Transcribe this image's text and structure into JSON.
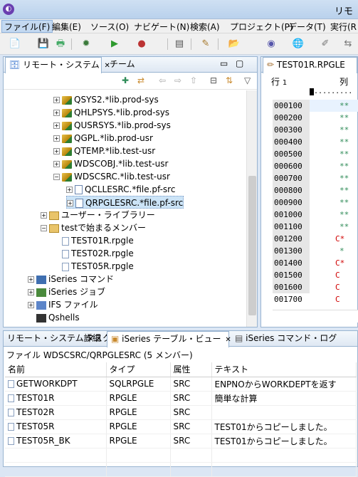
{
  "window": {
    "title": "リモ"
  },
  "menu": [
    "ファイル(F)",
    "編集(E)",
    "ソース(O)",
    "ナビゲート(N)",
    "検索(A)",
    "プロジェクト(P)",
    "データ(T)",
    "実行(R"
  ],
  "left_panel": {
    "tabs": [
      {
        "label": "リモート・システム"
      },
      {
        "label": "チーム"
      }
    ],
    "tree": [
      {
        "label": "QSYS2.*lib.prod-sys",
        "kind": "lib",
        "depth": 2,
        "expanded": false
      },
      {
        "label": "QHLPSYS.*lib.prod-sys",
        "kind": "lib",
        "depth": 2,
        "expanded": false
      },
      {
        "label": "QUSRSYS.*lib.prod-sys",
        "kind": "lib",
        "depth": 2,
        "expanded": false
      },
      {
        "label": "QGPL.*lib.prod-usr",
        "kind": "lib",
        "depth": 2,
        "expanded": false
      },
      {
        "label": "QTEMP.*lib.test-usr",
        "kind": "lib",
        "depth": 2,
        "expanded": false
      },
      {
        "label": "WDSCOBJ.*lib.test-usr",
        "kind": "lib",
        "depth": 2,
        "expanded": false
      },
      {
        "label": "WDSCSRC.*lib.test-usr",
        "kind": "lib",
        "depth": 2,
        "expanded": true
      },
      {
        "label": "QCLLESRC.*file.pf-src",
        "kind": "file",
        "depth": 3,
        "expanded": false
      },
      {
        "label": "QRPGLESRC.*file.pf-src",
        "kind": "file",
        "depth": 3,
        "expanded": false,
        "selected": true
      },
      {
        "label": "ユーザー・ライブラリー",
        "kind": "folder",
        "depth": 1,
        "expanded": false
      },
      {
        "label": "testで始まるメンバー",
        "kind": "folder",
        "depth": 1,
        "expanded": true
      },
      {
        "label": "TEST01R.rpgle",
        "kind": "member",
        "depth": 2
      },
      {
        "label": "TEST02R.rpgle",
        "kind": "member",
        "depth": 2
      },
      {
        "label": "TEST05R.rpgle",
        "kind": "member",
        "depth": 2
      },
      {
        "label": "iSeries コマンド",
        "kind": "cmd",
        "depth": 0,
        "expanded": false
      },
      {
        "label": "iSeries ジョブ",
        "kind": "job",
        "depth": 0,
        "expanded": false
      },
      {
        "label": "IFS ファイル",
        "kind": "ifs",
        "depth": 0,
        "expanded": false
      },
      {
        "label": "Qshells",
        "kind": "shell",
        "depth": 0
      }
    ]
  },
  "editor": {
    "tab_label": "TEST01R.RPGLE",
    "ruler_row": "行",
    "ruler_num": "1",
    "ruler_col": "列",
    "lines": [
      {
        "num": "000100",
        "mark": "**"
      },
      {
        "num": "000200",
        "mark": "**"
      },
      {
        "num": "000300",
        "mark": "**"
      },
      {
        "num": "000400",
        "mark": "**"
      },
      {
        "num": "000500",
        "mark": "**"
      },
      {
        "num": "000600",
        "mark": "**"
      },
      {
        "num": "000700",
        "mark": "**"
      },
      {
        "num": "000800",
        "mark": "**"
      },
      {
        "num": "000900",
        "mark": "**"
      },
      {
        "num": "001000",
        "mark": "**"
      },
      {
        "num": "001100",
        "mark": "**"
      },
      {
        "num": "001200",
        "mark": "C*"
      },
      {
        "num": "001300",
        "mark": "*"
      },
      {
        "num": "001400",
        "mark": "C*"
      },
      {
        "num": "001500",
        "mark": "C"
      },
      {
        "num": "001600",
        "mark": "C"
      },
      {
        "num": "001700",
        "mark": "C"
      }
    ]
  },
  "bottom_panel": {
    "tabs": [
      {
        "label": "リモート・システム詳細"
      },
      {
        "label": "タスク"
      },
      {
        "label": "iSeries テーブル・ビュー"
      },
      {
        "label": "iSeries コマンド・ログ"
      }
    ],
    "caption": "ファイル WDSCSRC/QRPGLESRC (5 メンバー)",
    "columns": [
      "名前",
      "タイプ",
      "属性",
      "テキスト"
    ],
    "rows": [
      [
        "GETWORKDPT",
        "SQLRPGLE",
        "SRC",
        "ENPNOからWORKDEPTを返す"
      ],
      [
        "TEST01R",
        "RPGLE",
        "SRC",
        "簡単な計算"
      ],
      [
        "TEST02R",
        "RPGLE",
        "SRC",
        ""
      ],
      [
        "TEST05R",
        "RPGLE",
        "SRC",
        "TEST01からコピーしました。"
      ],
      [
        "TEST05R_BK",
        "RPGLE",
        "SRC",
        "TEST01からコピーしました。"
      ]
    ]
  },
  "colors": {
    "accent": "#99b4d1",
    "selection": "#cce4f7",
    "editor_mark": "#2e8b57",
    "editor_c": "#d00000"
  }
}
